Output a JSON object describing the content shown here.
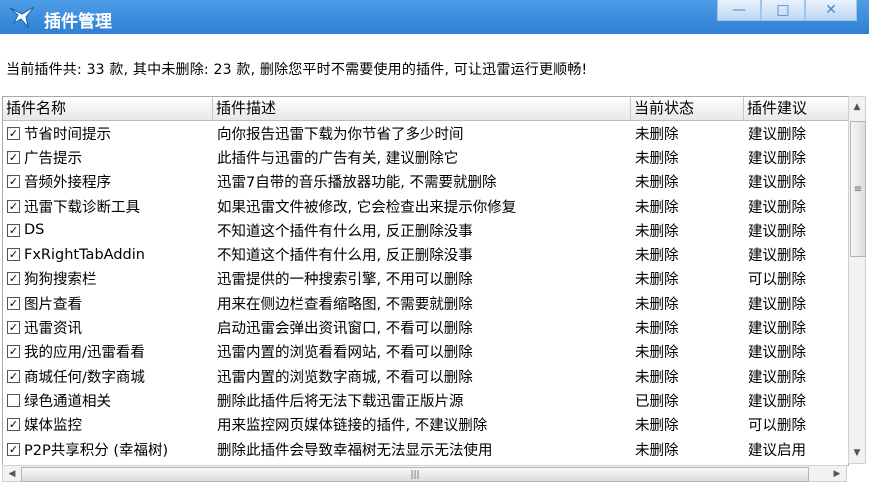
{
  "window": {
    "title": "插件管理",
    "minimize_glyph": "—",
    "maximize_glyph": "□",
    "close_glyph": "✕"
  },
  "summary": "当前插件共: 33 款, 其中未删除: 23 款, 删除您平时不需要使用的插件, 可让迅雷运行更顺畅!",
  "columns": [
    "插件名称",
    "插件描述",
    "当前状态",
    "插件建议"
  ],
  "rows": [
    {
      "checked": true,
      "name": "节省时间提示",
      "desc": "向你报告迅雷下载为你节省了多少时间",
      "status": "未删除",
      "advice": "建议删除"
    },
    {
      "checked": true,
      "name": "广告提示",
      "desc": "此插件与迅雷的广告有关, 建议删除它",
      "status": "未删除",
      "advice": "建议删除"
    },
    {
      "checked": true,
      "name": "音频外接程序",
      "desc": "迅雷7自带的音乐播放器功能, 不需要就删除",
      "status": "未删除",
      "advice": "建议删除"
    },
    {
      "checked": true,
      "name": "迅雷下载诊断工具",
      "desc": "如果迅雷文件被修改, 它会检查出来提示你修复",
      "status": "未删除",
      "advice": "建议删除"
    },
    {
      "checked": true,
      "name": "DS",
      "desc": "不知道这个插件有什么用, 反正删除没事",
      "status": "未删除",
      "advice": "建议删除"
    },
    {
      "checked": true,
      "name": "FxRightTabAddin",
      "desc": "不知道这个插件有什么用, 反正删除没事",
      "status": "未删除",
      "advice": "建议删除"
    },
    {
      "checked": true,
      "name": "狗狗搜索栏",
      "desc": "迅雷提供的一种搜索引擎, 不用可以删除",
      "status": "未删除",
      "advice": "可以删除"
    },
    {
      "checked": true,
      "name": "图片查看",
      "desc": "用来在侧边栏查看缩略图, 不需要就删除",
      "status": "未删除",
      "advice": "建议删除"
    },
    {
      "checked": true,
      "name": "迅雷资讯",
      "desc": "启动迅雷会弹出资讯窗口, 不看可以删除",
      "status": "未删除",
      "advice": "建议删除"
    },
    {
      "checked": true,
      "name": "我的应用/迅雷看看",
      "desc": "迅雷内置的浏览看看网站, 不看可以删除",
      "status": "未删除",
      "advice": "建议删除"
    },
    {
      "checked": true,
      "name": "商城任何/数字商城",
      "desc": "迅雷内置的浏览数字商城, 不看可以删除",
      "status": "未删除",
      "advice": "建议删除"
    },
    {
      "checked": false,
      "name": "绿色通道相关",
      "desc": "删除此插件后将无法下载迅雷正版片源",
      "status": "已删除",
      "advice": "建议删除"
    },
    {
      "checked": true,
      "name": "媒体监控",
      "desc": "用来监控网页媒体链接的插件, 不建议删除",
      "status": "未删除",
      "advice": "可以删除"
    },
    {
      "checked": true,
      "name": "P2P共享积分 (幸福树)",
      "desc": "删除此插件会导致幸福树无法显示无法使用",
      "status": "未删除",
      "advice": "建议启用"
    }
  ]
}
